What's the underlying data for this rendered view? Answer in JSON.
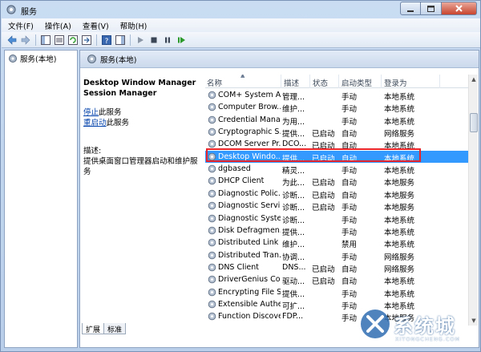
{
  "window": {
    "title": "服务"
  },
  "menu": [
    "文件(F)",
    "操作(A)",
    "查看(V)",
    "帮助(H)"
  ],
  "tree": {
    "root_label": "服务(本地)"
  },
  "panel": {
    "header_label": "服务(本地)"
  },
  "details": {
    "service_title_line1": "Desktop Window Manager",
    "service_title_line2": "Session Manager",
    "stop_link": "停止",
    "stop_suffix": "此服务",
    "restart_link": "重启动",
    "restart_suffix": "此服务",
    "desc_label": "描述:",
    "desc_text": "提供桌面窗口管理器启动和维护服务"
  },
  "columns": {
    "name": "名称",
    "desc": "描述",
    "status": "状态",
    "start": "启动类型",
    "logon": "登录为"
  },
  "rows": [
    {
      "name": "COM+ System A...",
      "desc": "管理...",
      "status": "",
      "start": "手动",
      "logon": "本地系统"
    },
    {
      "name": "Computer Brow...",
      "desc": "维护...",
      "status": "",
      "start": "手动",
      "logon": "本地系统"
    },
    {
      "name": "Credential Mana...",
      "desc": "为用...",
      "status": "",
      "start": "手动",
      "logon": "本地系统"
    },
    {
      "name": "Cryptographic S...",
      "desc": "提供...",
      "status": "已启动",
      "start": "自动",
      "logon": "网络服务"
    },
    {
      "name": "DCOM Server Pr...",
      "desc": "DCO...",
      "status": "已启动",
      "start": "自动",
      "logon": "本地系统"
    },
    {
      "name": "Desktop Windo...",
      "desc": "提供...",
      "status": "已启动",
      "start": "自动",
      "logon": "本地系统"
    },
    {
      "name": "dgbased",
      "desc": "精灵...",
      "status": "",
      "start": "手动",
      "logon": "本地系统"
    },
    {
      "name": "DHCP Client",
      "desc": "为此...",
      "status": "已启动",
      "start": "自动",
      "logon": "本地服务"
    },
    {
      "name": "Diagnostic Polic...",
      "desc": "诊断...",
      "status": "已启动",
      "start": "自动",
      "logon": "本地服务"
    },
    {
      "name": "Diagnostic Servi...",
      "desc": "诊断...",
      "status": "已启动",
      "start": "手动",
      "logon": "本地服务"
    },
    {
      "name": "Diagnostic Syste...",
      "desc": "诊断...",
      "status": "",
      "start": "手动",
      "logon": "本地系统"
    },
    {
      "name": "Disk Defragmen...",
      "desc": "提供...",
      "status": "",
      "start": "手动",
      "logon": "本地系统"
    },
    {
      "name": "Distributed Link ...",
      "desc": "维护...",
      "status": "",
      "start": "禁用",
      "logon": "本地系统"
    },
    {
      "name": "Distributed Tran...",
      "desc": "协调...",
      "status": "",
      "start": "手动",
      "logon": "网络服务"
    },
    {
      "name": "DNS Client",
      "desc": "DNS...",
      "status": "已启动",
      "start": "自动",
      "logon": "网络服务"
    },
    {
      "name": "DriverGenius Co...",
      "desc": "驱动...",
      "status": "已启动",
      "start": "自动",
      "logon": "本地系统"
    },
    {
      "name": "Encrypting File S...",
      "desc": "提供...",
      "status": "",
      "start": "手动",
      "logon": "本地系统"
    },
    {
      "name": "Extensible Authe...",
      "desc": "可扩...",
      "status": "",
      "start": "手动",
      "logon": "本地系统"
    },
    {
      "name": "Function Discove...",
      "desc": "FDP...",
      "status": "",
      "start": "手动",
      "logon": "本地服务"
    }
  ],
  "selected_row": 5,
  "tabs": [
    "扩展",
    "标准"
  ],
  "watermark": {
    "text": "系统城",
    "url": "XITONGCHENG.COM"
  },
  "colors": {
    "selection": "#3399ff",
    "highlight_box": "#e8252b",
    "link": "#0645ad"
  }
}
